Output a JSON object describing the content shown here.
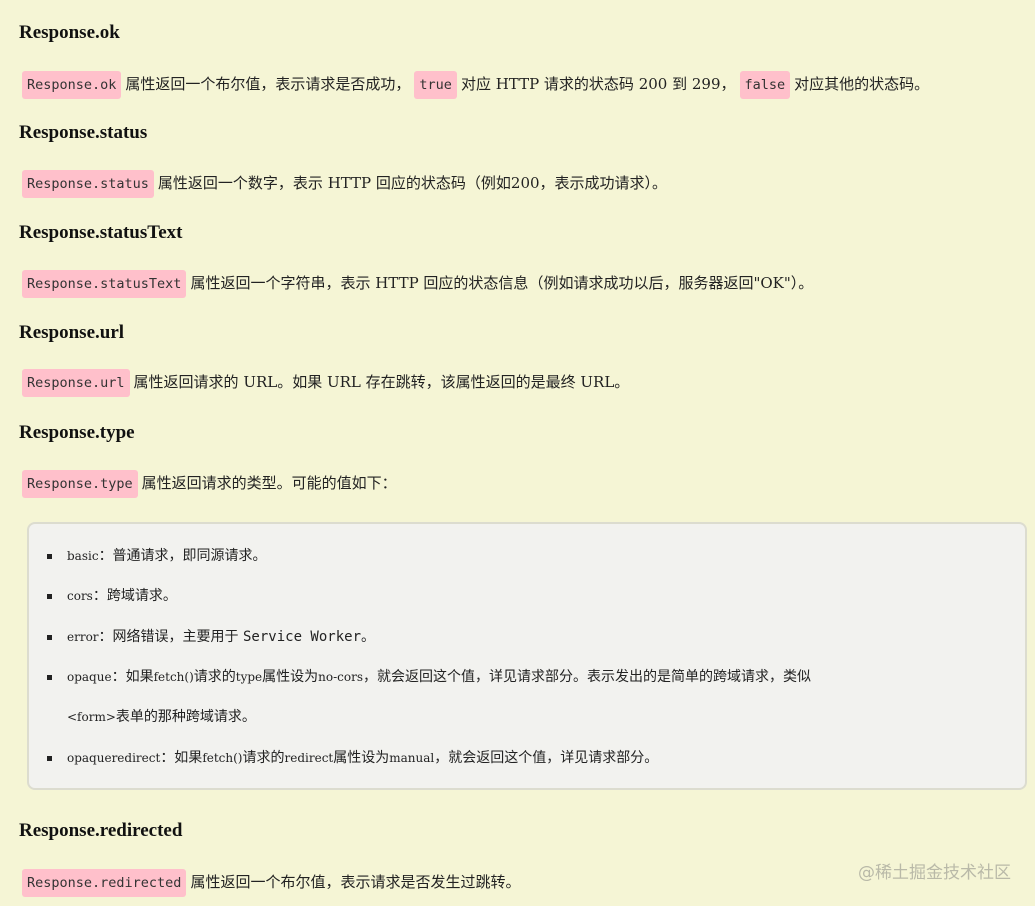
{
  "sections": {
    "ok": {
      "heading": "Response.ok",
      "code": "Response.ok",
      "text1": "属性返回一个布尔值，表示请求是否成功，",
      "code_true": "true",
      "text2": "对应 HTTP 请求的状态码 200 到 299，",
      "code_false": "false",
      "text3": "对应其他的状态码。"
    },
    "status": {
      "heading": "Response.status",
      "code": "Response.status",
      "text": "属性返回一个数字，表示 HTTP 回应的状态码（例如200，表示成功请求）。"
    },
    "statusText": {
      "heading": "Response.statusText",
      "code": "Response.statusText",
      "text": "属性返回一个字符串，表示 HTTP 回应的状态信息（例如请求成功以后，服务器返回\"OK\"）。"
    },
    "url": {
      "heading": "Response.url",
      "code": "Response.url",
      "text": "属性返回请求的 URL。如果 URL 存在跳转，该属性返回的是最终 URL。"
    },
    "type": {
      "heading": "Response.type",
      "code": "Response.type",
      "text": "属性返回请求的类型。可能的值如下："
    },
    "redirected": {
      "heading": "Response.redirected",
      "code": "Response.redirected",
      "text": "属性返回一个布尔值，表示请求是否发生过跳转。"
    }
  },
  "type_values": {
    "basic": {
      "key": "basic",
      "desc": "：普通请求，即同源请求。"
    },
    "cors": {
      "key": "cors",
      "desc": "：跨域请求。"
    },
    "error": {
      "key": "error",
      "desc": "：网络错误，主要用于 ",
      "tail": "Service Worker",
      "end": "。"
    },
    "opaque": {
      "key": "opaque",
      "desc1": "：如果",
      "fetch": "fetch()",
      "desc2": "请求的",
      "type": "type",
      "desc3": "属性设为",
      "nocors": "no-cors",
      "desc4": "，就会返回这个值，详见请求部分。表示发出的是简单的跨域请求，类似",
      "line2_tag": "<form>",
      "line2_text": "表单的那种跨域请求。"
    },
    "opaqueredirect": {
      "key": "opaqueredirect",
      "desc1": "：如果",
      "fetch": "fetch()",
      "desc2": "请求的",
      "redirect": "redirect",
      "desc3": "属性设为",
      "manual": "manual",
      "desc4": "，就会返回这个值，详见请求部分。"
    }
  },
  "watermark": "@稀土掘金技术社区",
  "colors": {
    "background": "#f5f5d5",
    "code_bg": "#ffc0cb",
    "note_bg": "#f2f2ef"
  }
}
